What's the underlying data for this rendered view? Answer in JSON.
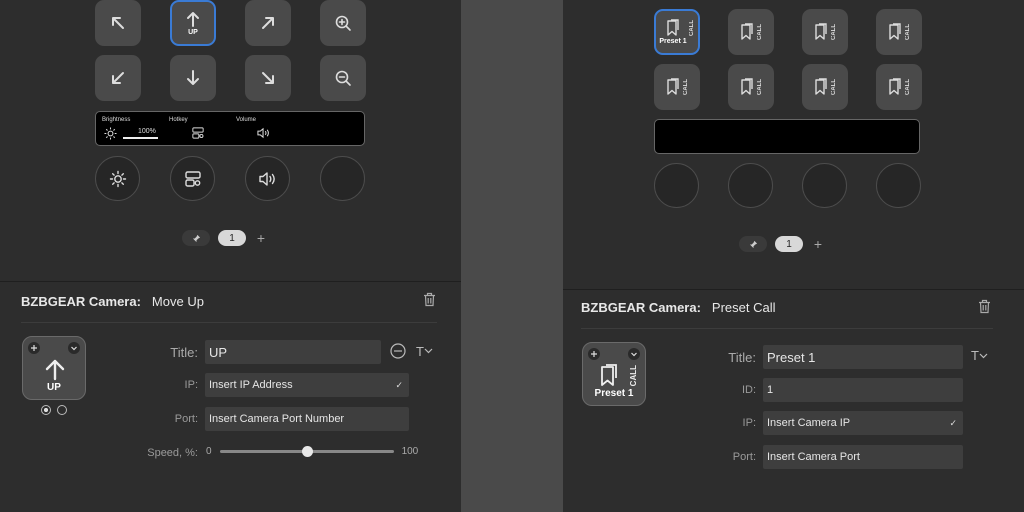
{
  "left": {
    "keys": {
      "up_label": "UP"
    },
    "display": {
      "brightness_label": "Brightness",
      "brightness_value": "100%",
      "brightness_level": 1.0,
      "hotkey_label": "Hotkey",
      "volume_label": "Volume"
    },
    "pager": {
      "page": "1"
    },
    "header": {
      "plugin": "BZBGEAR Camera:",
      "action": "Move Up"
    },
    "preview": {
      "label": "UP"
    },
    "fields": {
      "title_label": "Title:",
      "title_value": "UP",
      "ip_label": "IP:",
      "ip_value": "Insert IP Address",
      "port_label": "Port:",
      "port_value": "Insert Camera Port Number",
      "speed_label": "Speed, %:",
      "speed_min": "0",
      "speed_max": "100",
      "speed_value": 50
    }
  },
  "right": {
    "keys": {
      "preset_label": "Preset 1",
      "call_label": "CALL"
    },
    "pager": {
      "page": "1"
    },
    "header": {
      "plugin": "BZBGEAR Camera:",
      "action": "Preset Call"
    },
    "preview": {
      "label": "Preset 1",
      "call": "CALL"
    },
    "fields": {
      "title_label": "Title:",
      "title_value": "Preset 1",
      "id_label": "ID:",
      "id_value": "1",
      "ip_label": "IP:",
      "ip_value": "Insert Camera IP",
      "port_label": "Port:",
      "port_value": "Insert Camera Port"
    }
  },
  "icons": {
    "checkmark": "✓",
    "text_style": "T"
  },
  "colors": {
    "accent": "#3a7bd5",
    "panel": "#2d2d2d",
    "key": "#4a4a4a"
  }
}
